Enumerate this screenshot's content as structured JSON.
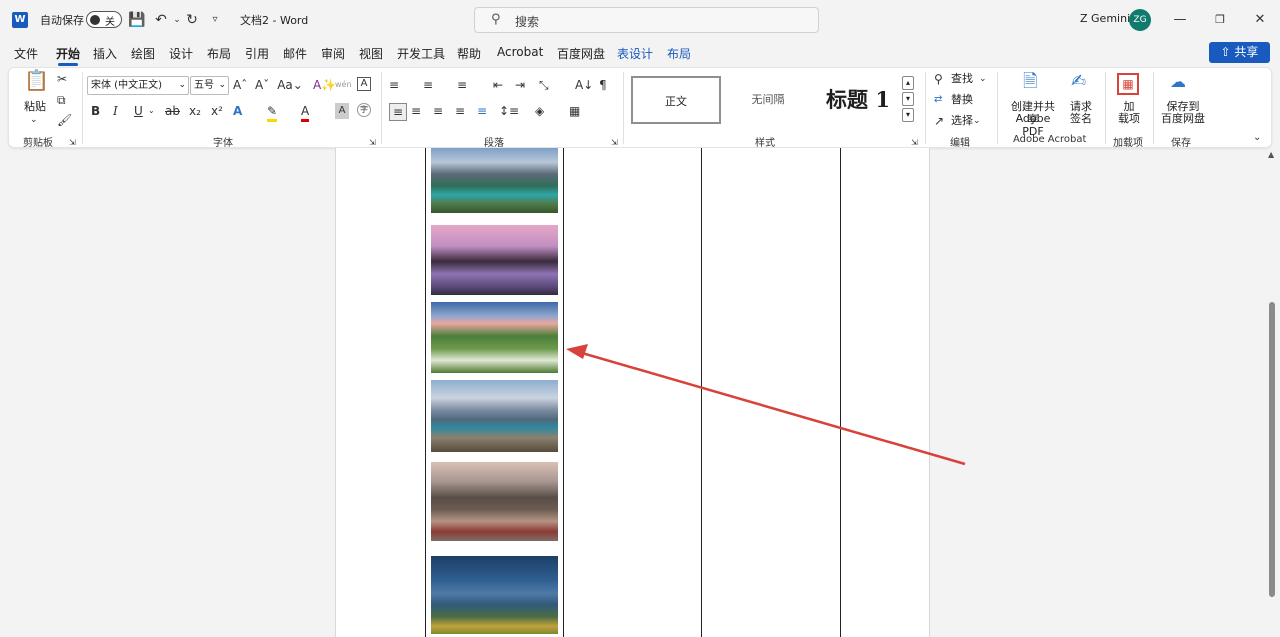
{
  "titlebar": {
    "autosave_label": "自动保存",
    "autosave_state": "关",
    "doc_title": "文档2 - Word",
    "search_placeholder": "搜索",
    "user_name": "Z Gemini",
    "avatar_initials": "ZG"
  },
  "menu": {
    "tabs": [
      "文件",
      "开始",
      "插入",
      "绘图",
      "设计",
      "布局",
      "引用",
      "邮件",
      "审阅",
      "视图",
      "开发工具",
      "帮助",
      "Acrobat",
      "百度网盘",
      "表设计",
      "布局"
    ],
    "active_tab": "开始",
    "share_label": "共享"
  },
  "ribbon": {
    "clipboard": {
      "paste_label": "粘贴",
      "group_label": "剪贴板"
    },
    "font": {
      "font_name": "宋体 (中文正文)",
      "font_size": "五号",
      "group_label": "字体",
      "change_case": "Aa"
    },
    "paragraph": {
      "group_label": "段落"
    },
    "styles": {
      "items": [
        "正文",
        "无间隔",
        "标题 1"
      ],
      "group_label": "样式"
    },
    "editing": {
      "find": "查找",
      "replace": "替换",
      "select": "选择",
      "group_label": "编辑"
    },
    "acrobat": {
      "create_share": "创建并共享",
      "create_share_2": "Adobe PDF",
      "request_sign": "请求",
      "request_sign_2": "签名",
      "group_label": "Adobe Acrobat"
    },
    "addins": {
      "label": "加",
      "label_2": "载项",
      "group_label": "加载项"
    },
    "save": {
      "label": "保存到",
      "label_2": "百度网盘",
      "group_label": "保存"
    }
  },
  "colors": {
    "accent": "#185abd",
    "arrow": "#d9423a",
    "avatar": "#0f7a6e"
  },
  "document": {
    "photos": [
      "mountain-lake",
      "purple-sunset-rocks",
      "flower-meadow",
      "alpine-lake",
      "mountain-reflection-boats",
      "tree-valley"
    ]
  }
}
